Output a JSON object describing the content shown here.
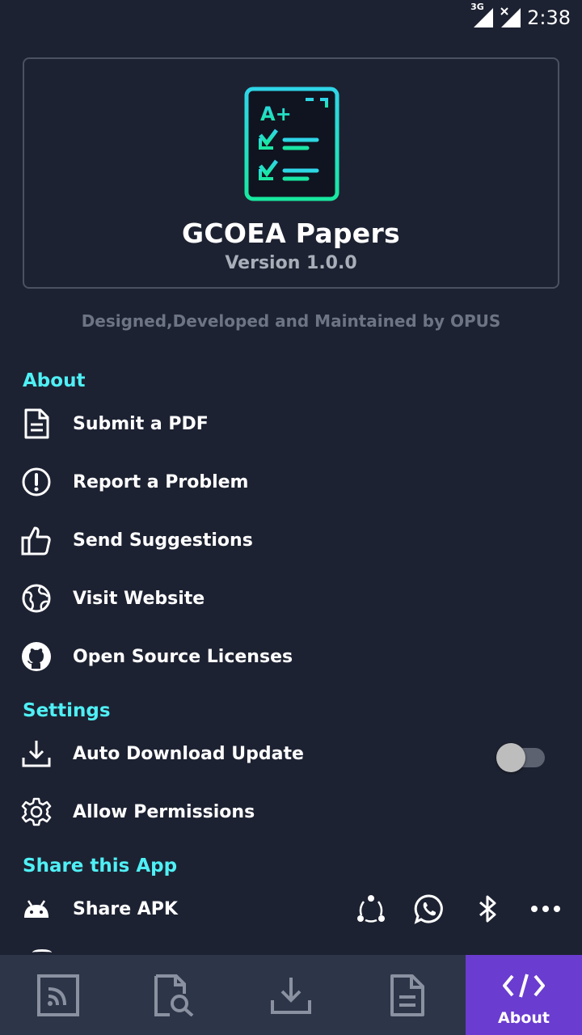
{
  "status_bar": {
    "network": "3G",
    "time": "2:38"
  },
  "header": {
    "app_name": "GCOEA Papers",
    "version": "Version 1.0.0",
    "logo_icon": "exam-checklist-icon",
    "logo_text": "A+"
  },
  "credit": "Designed,Developed and Maintained by OPUS",
  "sections": {
    "about": "About",
    "settings": "Settings",
    "share": "Share this App"
  },
  "about_items": [
    {
      "label": "Submit a PDF",
      "icon": "document-icon"
    },
    {
      "label": "Report a Problem",
      "icon": "alert-circle-icon"
    },
    {
      "label": "Send Suggestions",
      "icon": "thumbs-up-icon"
    },
    {
      "label": "Visit Website",
      "icon": "globe-icon"
    },
    {
      "label": "Open Source Licenses",
      "icon": "github-icon"
    }
  ],
  "settings_items": [
    {
      "label": "Auto Download Update",
      "icon": "download-icon",
      "toggle": false
    },
    {
      "label": "Allow Permissions",
      "icon": "gear-icon"
    }
  ],
  "share_items": [
    {
      "label": "Share APK",
      "icon": "android-icon"
    }
  ],
  "share_actions": [
    "share-it-icon",
    "whatsapp-icon",
    "bluetooth-icon",
    "more-icon"
  ],
  "bottom_nav": [
    {
      "icon": "feed-icon",
      "label": ""
    },
    {
      "icon": "search-document-icon",
      "label": ""
    },
    {
      "icon": "download-icon",
      "label": ""
    },
    {
      "icon": "document-icon",
      "label": ""
    },
    {
      "icon": "code-icon",
      "label": "About",
      "active": true
    }
  ],
  "colors": {
    "background": "#1d2232",
    "accent": "#4ff0f5",
    "active_tab": "#6a3cd0",
    "nav_bg": "#2d3548"
  }
}
